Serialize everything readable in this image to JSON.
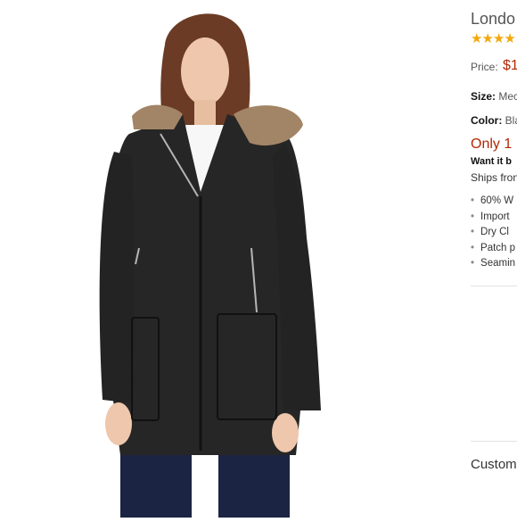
{
  "product": {
    "title": "Londo",
    "stars": "★★★★",
    "price_label": "Price:",
    "price": "$1",
    "size_label": "Size:",
    "size_value": "Mec",
    "color_label": "Color:",
    "color_value": "Bla",
    "stock": "Only 1",
    "want_it": "Want it b",
    "ships": "Ships fron",
    "features": [
      "60% W",
      "Import",
      "Dry Cl",
      "Patch p",
      "Seamin"
    ]
  },
  "customer_label": "Custom",
  "icons": {
    "image": "product-photo-icon",
    "star": "star-icon"
  },
  "colors": {
    "price": "#b12704",
    "stars": "#f2a80c"
  }
}
